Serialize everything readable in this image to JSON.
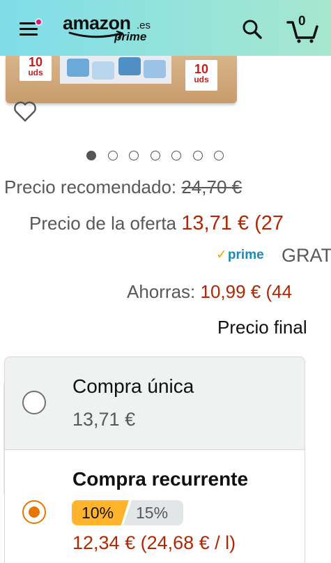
{
  "header": {
    "logo_word": "amazon",
    "logo_tld": ".es",
    "logo_prime": "prime",
    "cart_count": "0",
    "gradient_start": "#7fdde9",
    "gradient_end": "#a6e7ce",
    "icons": [
      "hamburger-menu-icon",
      "notification-dot",
      "search-icon",
      "cart-icon"
    ]
  },
  "product_image": {
    "tag_left_number": "10",
    "tag_left_unit": "uds",
    "tag_right_number": "10",
    "tag_right_unit": "uds"
  },
  "carousel": {
    "total": 7,
    "active_index": 0
  },
  "pricing": {
    "recommended_label": "Precio recomendado:",
    "recommended_value": "24,70 €",
    "offer_label": "Precio de la oferta",
    "offer_value": "13,71 € (27",
    "prime_label": "prime",
    "shipping_text": "GRAT",
    "savings_label": "Ahorras:",
    "savings_value": "10,99 € (44",
    "final_price_text": "Precio final"
  },
  "purchase_options": {
    "one_time_title": "Compra única",
    "one_time_price": "13,71 €",
    "recurring_title": "Compra recurrente",
    "discount_selected": "10%",
    "discount_other": "15%",
    "recurring_price": "12,34 € (24,68 € / l)",
    "accent": "#e77600",
    "price_color": "#b12704"
  }
}
